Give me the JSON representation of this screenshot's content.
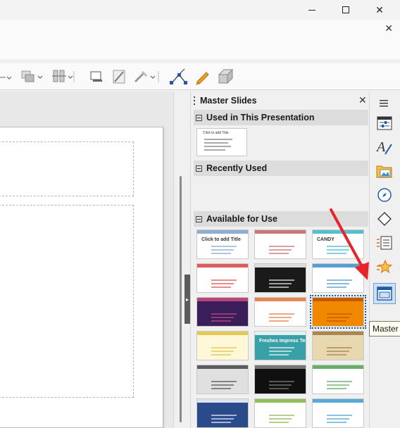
{
  "window": {
    "minimize_icon": "minimize-icon",
    "maximize_icon": "maximize-icon",
    "close_glyph": "✕",
    "doc_close_glyph": "✕"
  },
  "panel": {
    "title": "Master Slides",
    "close_glyph": "✕",
    "sections": {
      "used": "Used in This Presentation",
      "recent": "Recently Used",
      "available": "Available for Use"
    }
  },
  "used_thumb": {
    "title": "Click to add Title"
  },
  "available_thumbs": [
    {
      "name": "thumb-1-1",
      "title": "Click to add Title",
      "bg": "#ffffff",
      "accent": "#7aa0c8"
    },
    {
      "name": "thumb-1-2",
      "title": "",
      "bg": "#ffffff",
      "accent": "#c06060"
    },
    {
      "name": "thumb-1-3",
      "title": "CANDY",
      "bg": "#ffffff",
      "accent": "#3cb1c8"
    },
    {
      "name": "thumb-2-1",
      "title": "",
      "bg": "#ffffff",
      "accent": "#d94040"
    },
    {
      "name": "thumb-2-2",
      "title": "",
      "bg": "#1a1a1a",
      "accent": "#ffffff"
    },
    {
      "name": "thumb-2-3",
      "title": "",
      "bg": "#ffffff",
      "accent": "#3c8dc8"
    },
    {
      "name": "thumb-3-1",
      "title": "",
      "bg": "#3a1e5a",
      "accent": "#d05080"
    },
    {
      "name": "thumb-3-2",
      "title": "",
      "bg": "#ffffff",
      "accent": "#e07030"
    },
    {
      "name": "thumb-3-3",
      "title": "",
      "bg": "#f08800",
      "accent": "#c05000"
    },
    {
      "name": "thumb-4-1",
      "title": "",
      "bg": "#fff8d8",
      "accent": "#e0c040"
    },
    {
      "name": "thumb-4-2",
      "title": "Freshes Impress Template",
      "bg": "#3aa0a8",
      "accent": "#ffffff"
    },
    {
      "name": "thumb-4-3",
      "title": "",
      "bg": "#e8d8b0",
      "accent": "#a07840"
    },
    {
      "name": "thumb-5-1",
      "title": "",
      "bg": "#e0e0e0",
      "accent": "#444444"
    },
    {
      "name": "thumb-5-2",
      "title": "",
      "bg": "#101010",
      "accent": "#888888"
    },
    {
      "name": "thumb-5-3",
      "title": "",
      "bg": "#ffffff",
      "accent": "#50a050"
    },
    {
      "name": "thumb-6-1",
      "title": "",
      "bg": "#2a4a8a",
      "accent": "#ffffff"
    },
    {
      "name": "thumb-6-2",
      "title": "",
      "bg": "#ffffff",
      "accent": "#80b040"
    },
    {
      "name": "thumb-6-3",
      "title": "",
      "bg": "#ffffff",
      "accent": "#3c9ad0"
    }
  ],
  "deck": {
    "buttons": [
      "menu-icon",
      "properties-icon",
      "styles-icon",
      "gallery-icon",
      "navigator-icon",
      "shapes-icon",
      "slide-transition-icon",
      "animation-icon",
      "master-slides-icon"
    ]
  },
  "tooltip": {
    "text": "Master Slides"
  },
  "colors": {
    "accent": "#1e5aa8",
    "arrow": "#e8232a"
  }
}
